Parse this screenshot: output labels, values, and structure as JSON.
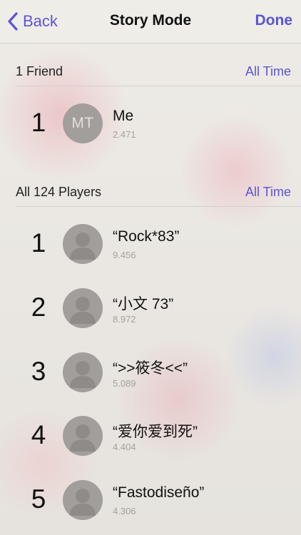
{
  "nav": {
    "back_label": "Back",
    "title": "Story Mode",
    "done_label": "Done"
  },
  "friends_section": {
    "title": "1 Friend",
    "filter": "All Time",
    "rows": [
      {
        "rank": "1",
        "avatar": "MT",
        "name": "Me",
        "score": "2.471"
      }
    ]
  },
  "players_section": {
    "title": "All 124 Players",
    "filter": "All Time",
    "rows": [
      {
        "rank": "1",
        "name": "“Rock*83”",
        "score": "9.456",
        "avatar_icon": "person-silhouette-icon"
      },
      {
        "rank": "2",
        "name": "“小文 73”",
        "score": "8.972",
        "avatar_icon": "person-silhouette-icon"
      },
      {
        "rank": "3",
        "name": "“>>筱冬<<”",
        "score": "5.089",
        "avatar_icon": "person-silhouette-icon"
      },
      {
        "rank": "4",
        "name": "“爱你爱到死”",
        "score": "4.404",
        "avatar_icon": "person-silhouette-icon"
      },
      {
        "rank": "5",
        "name": "“Fastodiseño”",
        "score": "4.306",
        "avatar_icon": "person-silhouette-icon"
      }
    ]
  },
  "colors": {
    "accent": "#5b55d6",
    "avatar_bg": "#a29e9b"
  }
}
